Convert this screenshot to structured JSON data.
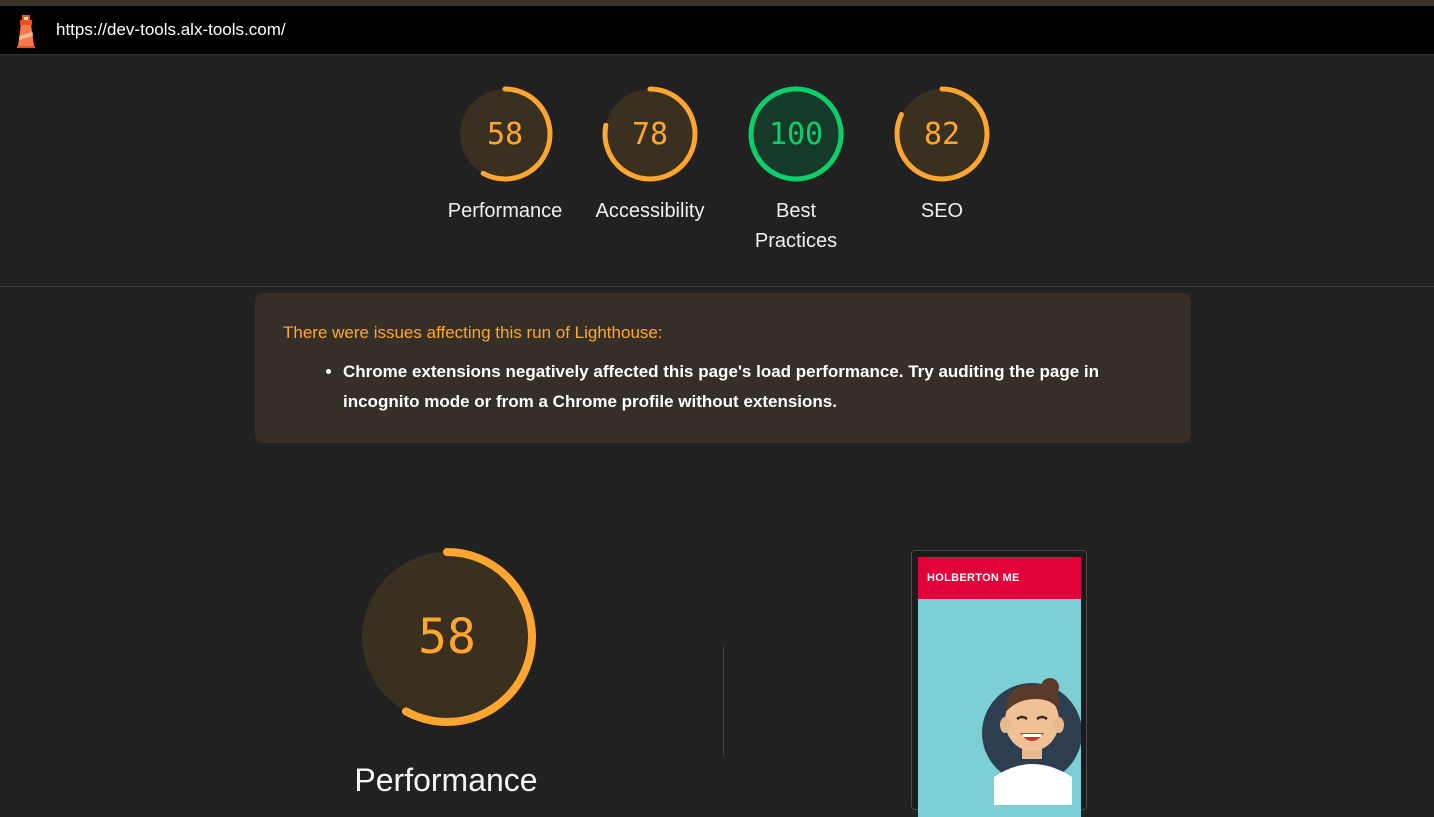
{
  "browser": {
    "url": "https://dev-tools.alx-tools.com/",
    "logo_icon": "lighthouse-icon"
  },
  "categories": [
    {
      "label": "Performance",
      "score": 58,
      "color": "#ffa631"
    },
    {
      "label": "Accessibility",
      "score": 78,
      "color": "#ffa631"
    },
    {
      "label": "Best Practices",
      "score": 100,
      "color": "#0cce6b"
    },
    {
      "label": "SEO",
      "score": 82,
      "color": "#ffa631"
    }
  ],
  "warning": {
    "title": "There were issues affecting this run of Lighthouse:",
    "items": [
      "Chrome extensions negatively affected this page's load performance. Try auditing the page in incognito mode or from a Chrome profile without extensions."
    ]
  },
  "performance_section": {
    "score": 58,
    "label": "Performance",
    "color": "#ffa631"
  },
  "screenshot_preview": {
    "site_title": "HOLBERTON ME",
    "header_color": "#e2003a",
    "background_color": "#7ccfd5"
  }
}
